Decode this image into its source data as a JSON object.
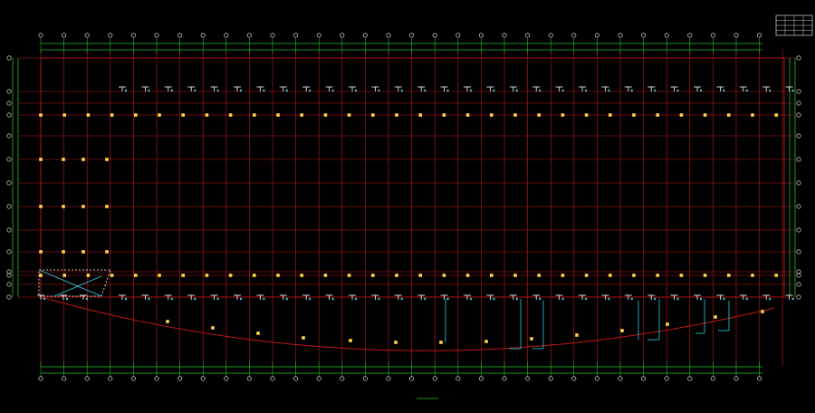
{
  "drawing": {
    "background": "#000000",
    "colors": {
      "grid": "#c01818",
      "axis": "#1fbf2a",
      "bubble": "#ffffff",
      "column": "#ffd54a",
      "pipe": "#28d0e0",
      "marker": "#ffffff",
      "curve": "#c01818"
    },
    "top_dimension_label": "",
    "bottom_dimension_label": "",
    "title_block": {
      "title": "",
      "scale": ""
    },
    "legend_table": {
      "header": "",
      "rows": [
        [
          "",
          "",
          "",
          ""
        ],
        [
          "",
          "",
          "",
          ""
        ],
        [
          "",
          "",
          "",
          ""
        ],
        [
          "",
          "",
          "",
          ""
        ]
      ]
    }
  }
}
